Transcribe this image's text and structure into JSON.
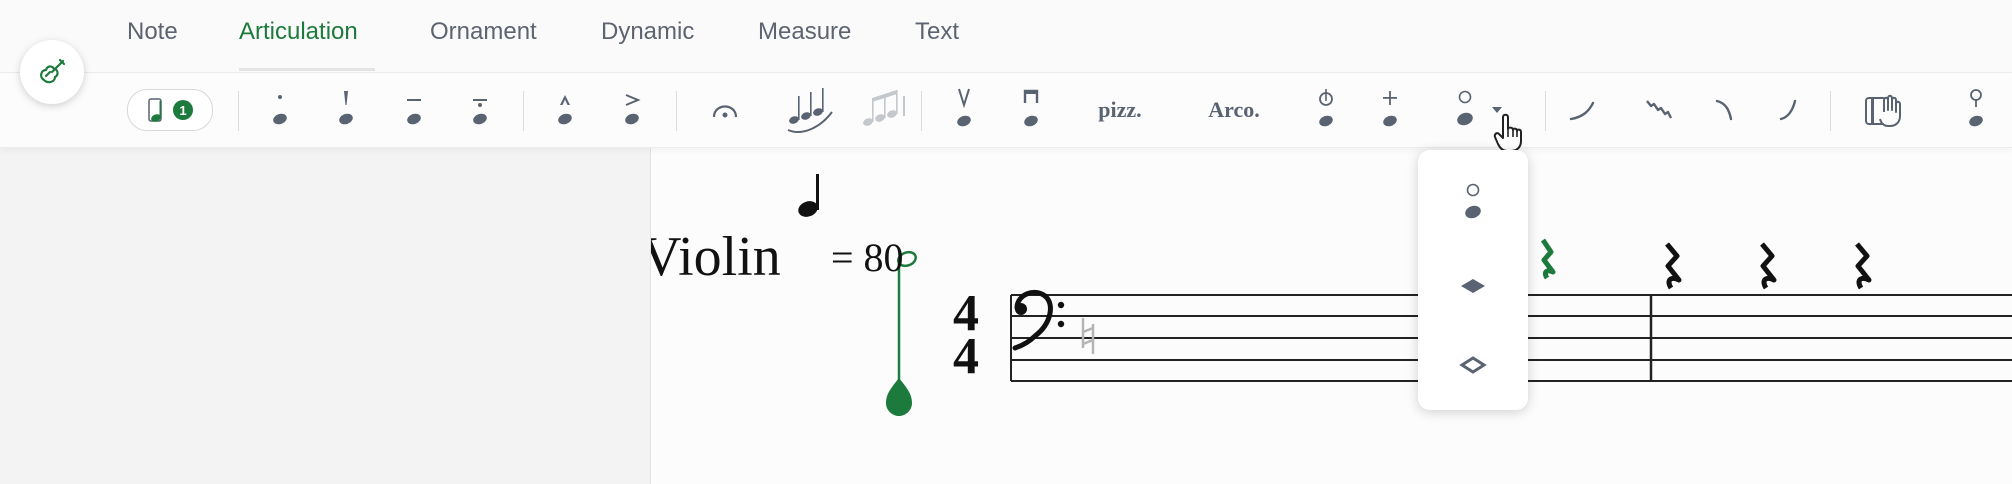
{
  "tabs": [
    {
      "label": "Note",
      "active": false
    },
    {
      "label": "Articulation",
      "active": true
    },
    {
      "label": "Ornament",
      "active": false
    },
    {
      "label": "Dynamic",
      "active": false
    },
    {
      "label": "Measure",
      "active": false
    },
    {
      "label": "Text",
      "active": false
    }
  ],
  "toolbar": {
    "selection_count": "1",
    "pizz_label": "pizz.",
    "arco_label": "Arco."
  },
  "score": {
    "instrument": "Violin",
    "tempo_value": "= 80",
    "time_signature_top": "4",
    "time_signature_bottom": "4"
  },
  "colors": {
    "accent": "#1c7a3c",
    "icon": "#5a6372"
  }
}
